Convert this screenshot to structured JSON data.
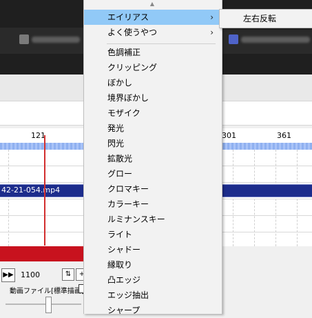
{
  "timeline": {
    "ruler_labels": [
      "121",
      "301",
      "361"
    ],
    "clip_label": "42-21-054.mp4",
    "frame_number": "1100",
    "bottom_label": "動画ファイル[標準描画]"
  },
  "context_menu": {
    "scroll_up": "▲",
    "items": [
      {
        "label": "エイリアス",
        "has_submenu": true
      },
      {
        "label": "よく使うやつ",
        "has_submenu": true
      },
      {
        "label": "色調補正"
      },
      {
        "label": "クリッピング"
      },
      {
        "label": "ぼかし"
      },
      {
        "label": "境界ぼかし"
      },
      {
        "label": "モザイク"
      },
      {
        "label": "発光"
      },
      {
        "label": "閃光"
      },
      {
        "label": "拡散光"
      },
      {
        "label": "グロー"
      },
      {
        "label": "クロマキー"
      },
      {
        "label": "カラーキー"
      },
      {
        "label": "ルミナンスキー"
      },
      {
        "label": "ライト"
      },
      {
        "label": "シャドー"
      },
      {
        "label": "縁取り"
      },
      {
        "label": "凸エッジ"
      },
      {
        "label": "エッジ抽出"
      },
      {
        "label": "シャープ"
      }
    ],
    "submenu_arrow": "›"
  },
  "submenu": {
    "items": [
      {
        "label": "左右反転"
      }
    ]
  },
  "colors": {
    "highlight": "#91c9f7",
    "clip": "#1c2c8c",
    "cursor": "#d22d2d",
    "red_bar": "#c8121e"
  }
}
